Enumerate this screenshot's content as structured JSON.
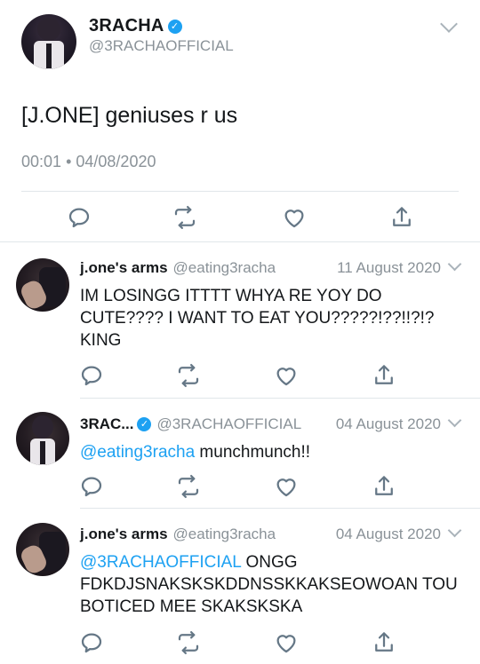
{
  "main_tweet": {
    "name": "3RACHA",
    "verified_mark": "✓",
    "handle": "@3RACHAOFFICIAL",
    "text": "[J.ONE] geniuses r us",
    "time": "00:01",
    "date": "04/08/2020",
    "time_separator": "•",
    "actions": [
      "reply-icon",
      "retweet-icon",
      "like-icon",
      "share-icon"
    ]
  },
  "replies": [
    {
      "name": "j.one's arms",
      "handle": "@eating3racha",
      "date": "11 August 2020",
      "mention": "",
      "text": "IM LOSINGG ITTTT WHYA RE YOY DO CUTE???? I WANT TO EAT YOU?????!??!!?!? KING",
      "avatar": "hand-avatar"
    },
    {
      "name": "3RAC...",
      "verified_mark": "✓",
      "handle": "@3RACHAOFFICIAL",
      "date": "04 August 2020",
      "mention": "@eating3racha",
      "text": " munchmunch!!",
      "avatar": "group-avatar"
    },
    {
      "name": "j.one's arms",
      "handle": "@eating3racha",
      "date": "04 August 2020",
      "mention": "@3RACHAOFFICIAL",
      "text": " ONGG FDKDJSNAKSKSKDDNSSKKAKSEOWOAN TOU BOTICED MEE SKAKSKSKA",
      "avatar": "hand-avatar"
    }
  ],
  "colors": {
    "link": "#1da1f2",
    "verified": "#1da1f2",
    "secondary_text": "#8a9298",
    "icon": "#657786",
    "divider": "#e1e6ea"
  }
}
